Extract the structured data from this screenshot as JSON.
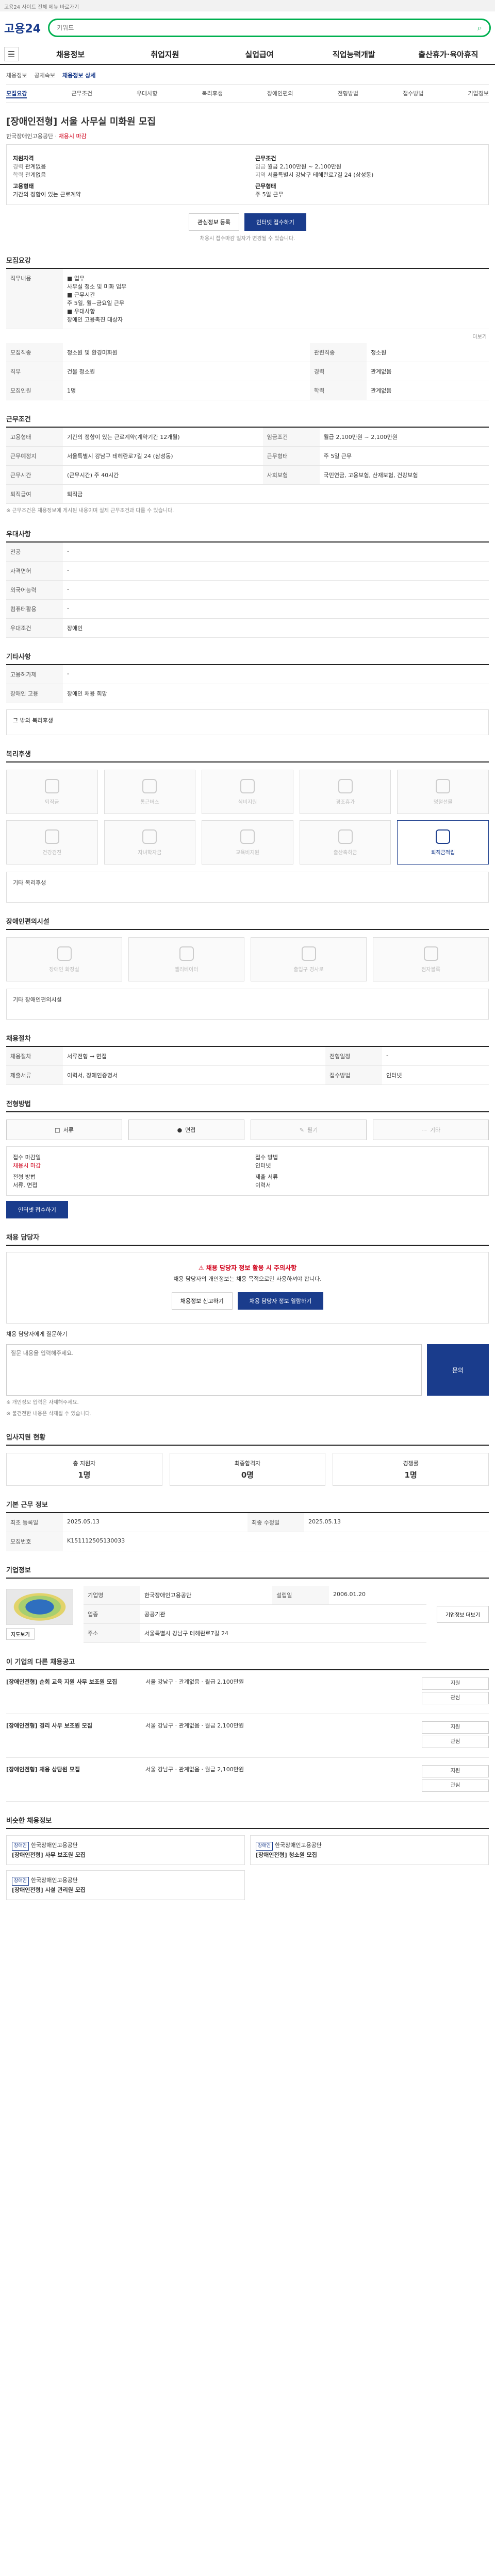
{
  "topbar": {
    "text": "고용24 사이트 전체 메뉴 바로가기"
  },
  "header": {
    "logo": "고용24",
    "logo_sub": "",
    "search_placeholder": "키워드"
  },
  "gnb": [
    "채용정보",
    "취업지원",
    "실업급여",
    "직업능력개발",
    "출산휴가·육아휴직"
  ],
  "breadcrumb": [
    "채용정보",
    "공채속보",
    "채용정보 상세"
  ],
  "tabs": [
    "모집요강",
    "근무조건",
    "우대사항",
    "복리후생",
    "장애인편의",
    "전형방법",
    "접수방법",
    "기업정보"
  ],
  "job": {
    "title": "[장애인전형] 서울 사무실 미화원 모집",
    "company": "한국장애인고용공단",
    "badge": "채용시 마감",
    "summary": [
      {
        "k": "지원자격",
        "v": ""
      },
      {
        "k": "경력",
        "v": "관계없음"
      },
      {
        "k": "학력",
        "v": "관계없음"
      },
      {
        "k": "근무조건",
        "v": ""
      },
      {
        "k": "임금",
        "v": "월급 2,100만원 ~ 2,100만원"
      },
      {
        "k": "지역",
        "v": "서울특별시 강남구 테헤란로7길 24 (삼성동)"
      },
      {
        "k": "고용형태",
        "v": "기간의 정함이 있는 근로계약"
      },
      {
        "k": "근무형태",
        "v": "주 5일 근무"
      }
    ],
    "buttons": {
      "scrap": "관심정보 등록",
      "apply": "인터넷 접수하기"
    },
    "notice": "채용시 접수마감 일자가 변경될 수 있습니다."
  },
  "section_recruit": {
    "title": "모집요강",
    "duty_label": "직무내용",
    "duty_text": "■ 업무\n사무실 청소 및 미화 업무\n■ 근무시간\n주 5일, 월~금요일 근무\n■ 우대사항\n장애인 고용촉진 대상자",
    "more": "더보기",
    "rows": [
      {
        "k": "모집직종",
        "v": "청소원 및 환경미화원"
      },
      {
        "k": "관련직종",
        "v": "청소원"
      },
      {
        "k": "직무",
        "v": "건물 청소원"
      },
      {
        "k": "경력",
        "v": "관계없음"
      },
      {
        "k": "모집인원",
        "v": "1명"
      },
      {
        "k": "학력",
        "v": "관계없음"
      }
    ]
  },
  "section_work": {
    "title": "근무조건",
    "rows": [
      {
        "k": "고용형태",
        "v": "기간의 정함이 있는 근로계약(계약기간 12개월)"
      },
      {
        "k": "임금조건",
        "v": "월급 2,100만원 ~ 2,100만원"
      },
      {
        "k": "근무예정지",
        "v": "서울특별시 강남구 테헤란로7길 24 (삼성동)"
      },
      {
        "k": "근무형태",
        "v": "주 5일 근무"
      },
      {
        "k": "근무시간",
        "v": "(근무시간) 주 40시간"
      },
      {
        "k": "사회보험",
        "v": "국민연금, 고용보험, 산재보험, 건강보험"
      },
      {
        "k": "퇴직급여",
        "v": "퇴직금"
      }
    ],
    "note": "※ 근무조건은 채용정보에 게시된 내용이며 실제 근무조건과 다를 수 있습니다."
  },
  "section_prefer": {
    "title": "우대사항",
    "rows": [
      {
        "k": "전공",
        "v": "-"
      },
      {
        "k": "자격면허",
        "v": "-"
      },
      {
        "k": "외국어능력",
        "v": "-"
      },
      {
        "k": "컴퓨터활용",
        "v": "-"
      },
      {
        "k": "우대조건",
        "v": "장애인"
      }
    ]
  },
  "section_etc": {
    "title": "기타사항",
    "rows": [
      {
        "k": "고용허가제",
        "v": "-"
      },
      {
        "k": "장애인 고용",
        "v": "장애인 채용 희망"
      }
    ],
    "pane": "그 밖의 복리후생"
  },
  "section_welfare": {
    "title": "복리후생",
    "items": [
      "퇴직금",
      "통근버스",
      "식비지원",
      "경조휴가",
      "명절선물",
      "건강검진",
      "자녀학자금",
      "교육비지원",
      "출산축하금",
      "퇴직금적립"
    ],
    "active_index": 9,
    "pane": "기타 복리후생"
  },
  "section_access": {
    "title": "장애인편의시설",
    "items": [
      "장애인 화장실",
      "엘리베이터",
      "출입구 경사로",
      "점자블록"
    ],
    "pane": "기타 장애인편의시설"
  },
  "section_career": {
    "title": "채용절차",
    "rows": [
      {
        "k": "채용절차",
        "v": "서류전형 → 면접"
      },
      {
        "k": "전형일정",
        "v": "-"
      },
      {
        "k": "제출서류",
        "v": "이력서, 장애인증명서"
      },
      {
        "k": "접수방법",
        "v": "인터넷"
      }
    ]
  },
  "section_process": {
    "title": "전형방법",
    "steps": [
      "서류",
      "면접",
      "필기",
      "기타"
    ],
    "apply": [
      {
        "k": "접수 마감일",
        "v": "채용시 마감"
      },
      {
        "k": "접수 방법",
        "v": "인터넷"
      },
      {
        "k": "전형 방법",
        "v": "서류, 면접"
      },
      {
        "k": "제출 서류",
        "v": "이력서"
      }
    ],
    "apply_button": "인터넷 접수하기"
  },
  "section_report": {
    "title": "채용 담당자",
    "warn_title": "채용 담당자 정보 활용 시 주의사항",
    "warn_text": "채용 담당자의 개인정보는 채용 목적으로만 사용하셔야 합니다.",
    "warn_buttons": [
      "채용정보 신고하기",
      "채용 담당자 정보 열람하기"
    ],
    "form_label": "채용 담당자에게 질문하기",
    "form_placeholder": "질문 내용을 입력해주세요.",
    "form_submit": "문의",
    "form_notes": [
      "※ 개인정보 입력은 자제해주세요.",
      "※ 불건전한 내용은 삭제될 수 있습니다."
    ]
  },
  "section_stats": {
    "title": "입사지원 현황",
    "items": [
      {
        "label": "총 지원자",
        "value": "1명"
      },
      {
        "label": "최종합격자",
        "value": "0명"
      },
      {
        "label": "경쟁률",
        "value": "1명"
      }
    ]
  },
  "section_basic": {
    "title": "기본 근무 정보",
    "rows": [
      {
        "k": "최초 등록일",
        "v": "2025.05.13"
      },
      {
        "k": "최종 수정일",
        "v": "2025.05.13"
      },
      {
        "k": "모집번호",
        "v": "K151112505130033"
      }
    ]
  },
  "section_company": {
    "title": "기업정보",
    "map_btn": "지도보기",
    "rows": [
      {
        "k": "기업명",
        "v": "한국장애인고용공단"
      },
      {
        "k": "업종",
        "v": "공공기관"
      },
      {
        "k": "주소",
        "v": "서울특별시 강남구 테헤란로7길 24"
      },
      {
        "k": "설립일",
        "v": "2006.01.20"
      }
    ],
    "more_btn": "기업정보 더보기"
  },
  "section_related": {
    "title": "이 기업의 다른 채용공고",
    "items": [
      {
        "title": "[장애인전형] 순회 교육 지원 사무 보조원 모집",
        "info": "서울 강남구 · 관계없음 · 월급 2,100만원",
        "btn1": "지원",
        "btn2": "관심"
      },
      {
        "title": "[장애인전형] 경리 사무 보조원 모집",
        "info": "서울 강남구 · 관계없음 · 월급 2,100만원",
        "btn1": "지원",
        "btn2": "관심"
      },
      {
        "title": "[장애인전형] 채용 상담원 모집",
        "info": "서울 강남구 · 관계없음 · 월급 2,100만원",
        "btn1": "지원",
        "btn2": "관심"
      }
    ]
  },
  "section_similar": {
    "title": "비슷한 채용정보",
    "items": [
      {
        "tag": "장애인",
        "company": "한국장애인고용공단",
        "title": "[장애인전형] 사무 보조원 모집"
      },
      {
        "tag": "장애인",
        "company": "한국장애인고용공단",
        "title": "[장애인전형] 청소원 모집"
      },
      {
        "tag": "장애인",
        "company": "한국장애인고용공단",
        "title": "[장애인전형] 시설 관리원 모집"
      }
    ]
  }
}
